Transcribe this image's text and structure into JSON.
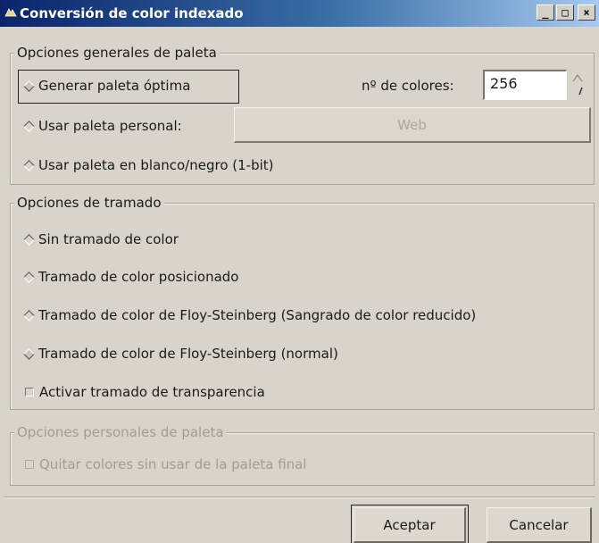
{
  "window": {
    "title": "Conversión de color indexado",
    "minimize_label": "_",
    "maximize_label": "□",
    "close_label": "×"
  },
  "palette_general": {
    "legend": "Opciones generales de paleta",
    "optimal_label": "Generar paleta óptima",
    "optimal_selected": true,
    "num_colors_label": "nº de colores:",
    "num_colors_value": "256",
    "custom_label": "Usar paleta personal:",
    "custom_button_label": "Web",
    "bw_label": "Usar paleta en blanco/negro (1-bit)"
  },
  "dither": {
    "legend": "Opciones de tramado",
    "options": [
      "Sin tramado de color",
      "Tramado de color posicionado",
      "Tramado de color de Floy-Steinberg (Sangrado de color reducido)",
      "Tramado de color de Floy-Steinberg (normal)"
    ],
    "selected_index": 3,
    "transparency_label": "Activar tramado de transparencia"
  },
  "palette_custom": {
    "legend": "Opciones personales de paleta",
    "remove_unused_label": "Quitar colores sin usar de la paleta final"
  },
  "buttons": {
    "ok_label": "Aceptar",
    "cancel_label": "Cancelar"
  }
}
